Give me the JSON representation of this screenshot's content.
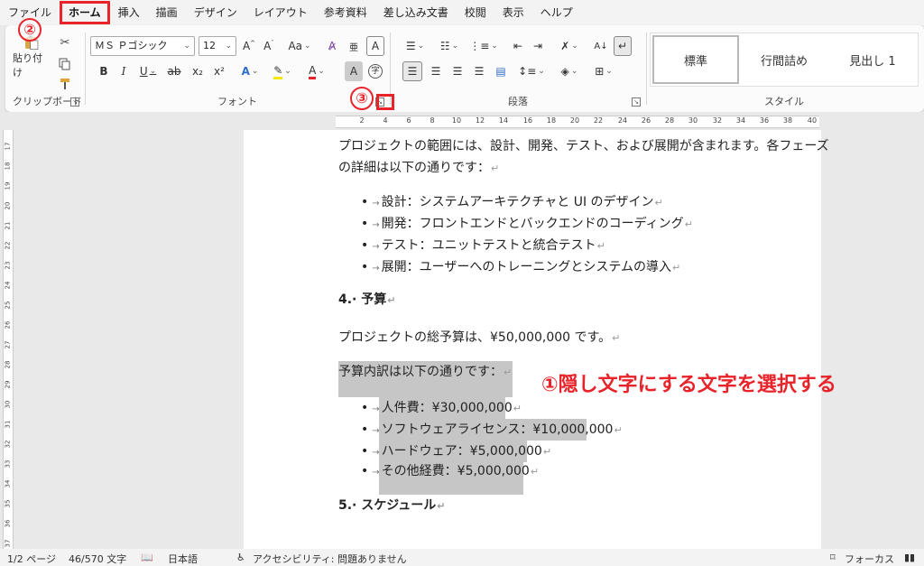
{
  "menu": {
    "tabs": [
      "ファイル",
      "ホーム",
      "挿入",
      "描画",
      "デザイン",
      "レイアウト",
      "参考資料",
      "差し込み文書",
      "校閲",
      "表示",
      "ヘルプ"
    ],
    "active_index": 1
  },
  "ribbon": {
    "clipboard": {
      "paste_label": "貼り付け",
      "group_label": "クリップボード"
    },
    "font": {
      "font_name": "ＭＳ Ｐゴシック",
      "font_size": "12",
      "grow_label": "A^",
      "shrink_label": "Aˇ",
      "case_label": "Aa",
      "bold": "B",
      "italic": "I",
      "underline": "U",
      "strike": "ab",
      "sub": "x₂",
      "sup": "x²",
      "group_label": "フォント"
    },
    "paragraph": {
      "group_label": "段落"
    },
    "styles": {
      "items": [
        "標準",
        "行間詰め",
        "見出し 1"
      ],
      "group_label": "スタイル"
    }
  },
  "annotations": {
    "step1": "①",
    "step1_text": "隠し文字にする文字を選択する",
    "step2": "②",
    "step3": "③",
    "color": "#e8232a"
  },
  "ruler": {
    "top_ticks": [
      "2",
      "4",
      "6",
      "8",
      "10",
      "12",
      "14",
      "16",
      "18",
      "20",
      "22",
      "24",
      "26",
      "28",
      "30",
      "32",
      "34",
      "36",
      "38",
      "40"
    ],
    "left_ticks": [
      "17",
      "18",
      "19",
      "20",
      "21",
      "22",
      "23",
      "24",
      "25",
      "26",
      "27",
      "28",
      "29",
      "30",
      "31",
      "32",
      "33",
      "34",
      "35",
      "36",
      "37"
    ]
  },
  "document": {
    "intro_line1": "プロジェクトの範囲には、設計、開発、テスト、および展開が含まれます。各フェーズ",
    "intro_line2": "の詳細は以下の通りです：",
    "scope_items": [
      "設計：システムアーキテクチャと UI のデザイン",
      "開発：フロントエンドとバックエンドのコーディング",
      "テスト：ユニットテストと統合テスト",
      "展開：ユーザーへのトレーニングとシステムの導入"
    ],
    "heading4": "4.· 予算",
    "budget_text": "プロジェクトの総予算は、¥50,000,000 です。",
    "breakdown_intro": "予算内訳は以下の通りです：",
    "breakdown_items": [
      "人件費：¥30,000,000",
      "ソフトウェアライセンス：¥10,000,000",
      "ハードウェア：¥5,000,000",
      "その他経費：¥5,000,000"
    ],
    "heading5": "5.· スケジュール",
    "para_mark": "↵"
  },
  "status": {
    "page": "1/2 ページ",
    "words": "46/570 文字",
    "language": "日本語",
    "accessibility": "アクセシビリティ: 問題ありません",
    "focus": "フォーカス"
  }
}
